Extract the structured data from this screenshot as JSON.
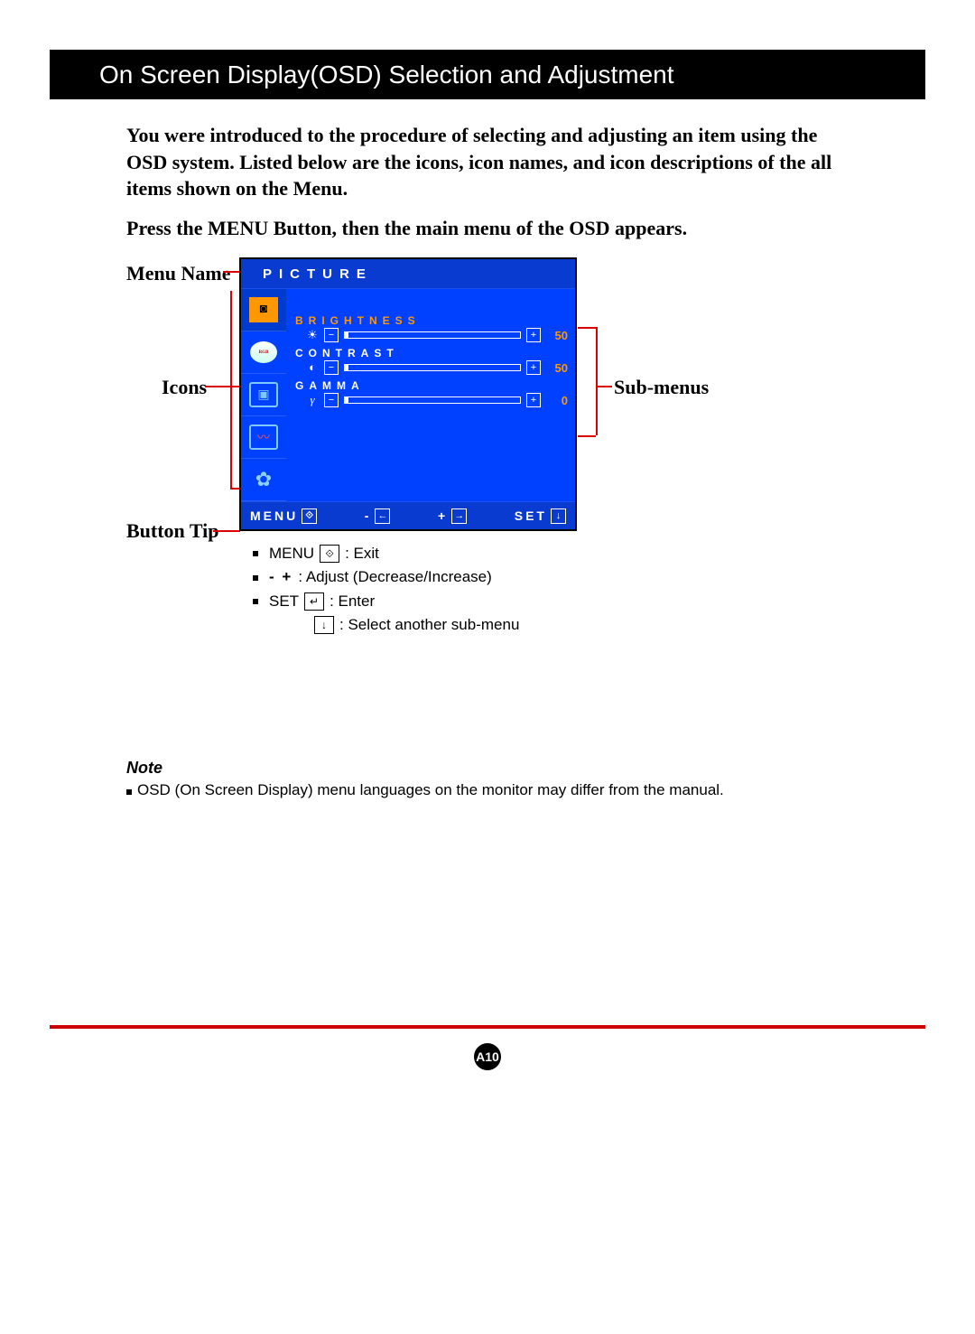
{
  "title": "On Screen Display(OSD) Selection and Adjustment",
  "intro": "You were introduced to the procedure of selecting and adjusting an item using the OSD system.  Listed below are the icons, icon names, and icon descriptions of the all items shown on the Menu.",
  "press": "Press the MENU Button, then the main menu of the OSD appears.",
  "labels": {
    "menuName": "Menu Name",
    "icons": "Icons",
    "subMenus": "Sub-menus",
    "buttonTip": "Button Tip"
  },
  "osd": {
    "menuName": "PICTURE",
    "submenus": [
      {
        "name": "BRIGHTNESS",
        "icon": "☀",
        "value": "50",
        "active": true
      },
      {
        "name": "CONTRAST",
        "icon": "◐",
        "value": "50",
        "active": false
      },
      {
        "name": "GAMMA",
        "icon": "γ",
        "value": "0",
        "active": false
      }
    ],
    "footer": {
      "menu": "MENU",
      "minus": "-",
      "plus": "+",
      "set": "SET"
    }
  },
  "tips": [
    {
      "lead": "MENU",
      "box": "⟐",
      "desc": ": Exit"
    },
    {
      "lead": "-  +",
      "box": "",
      "desc": ": Adjust (Decrease/Increase)"
    },
    {
      "lead": "SET",
      "box": "↵",
      "desc": ": Enter"
    },
    {
      "lead": "",
      "box": "↓",
      "desc": ": Select another sub-menu"
    }
  ],
  "note": {
    "h": "Note",
    "t": "OSD (On Screen Display) menu languages on the monitor may differ from the manual."
  },
  "pageNum": "A10"
}
